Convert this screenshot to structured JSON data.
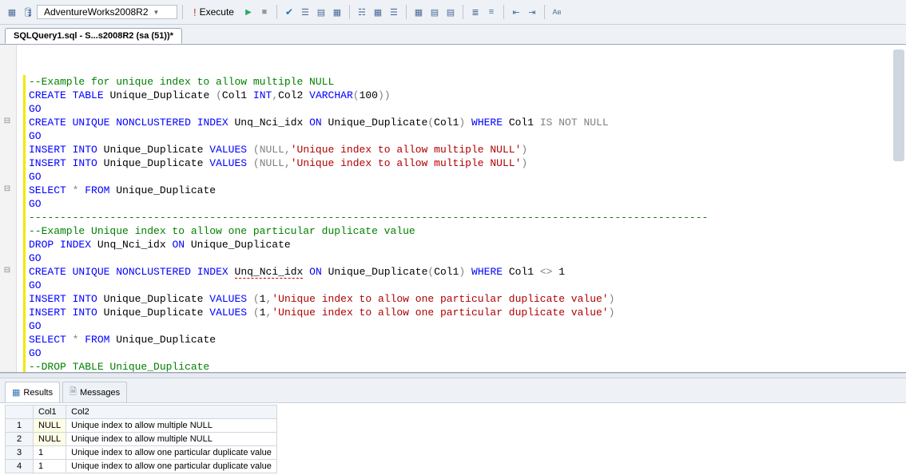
{
  "toolbar": {
    "database": "AdventureWorks2008R2",
    "execute_label": "Execute"
  },
  "tab": {
    "title": "SQLQuery1.sql - S...s2008R2 (sa (51))*"
  },
  "code_lines": [
    {
      "t": "cm",
      "text": "--Example for unique index to allow multiple NULL"
    },
    {
      "t": "sql",
      "html": "<span class='kw'>CREATE</span> <span class='kw'>TABLE</span> Unique_Duplicate <span class='gy'>(</span>Col1 <span class='kw'>INT</span><span class='gy'>,</span>Col2 <span class='kw'>VARCHAR</span><span class='gy'>(</span>100<span class='gy'>))</span>"
    },
    {
      "t": "kw",
      "text": "GO"
    },
    {
      "t": "sql",
      "html": "<span class='kw'>CREATE</span> <span class='kw'>UNIQUE</span> <span class='kw'>NONCLUSTERED</span> <span class='kw'>INDEX</span> Unq_Nci_idx <span class='kw'>ON</span> Unique_Duplicate<span class='gy'>(</span>Col1<span class='gy'>)</span> <span class='kw'>WHERE</span> Col1 <span class='gy'>IS NOT NULL</span>"
    },
    {
      "t": "kw",
      "text": "GO"
    },
    {
      "t": "sql",
      "html": "<span class='kw'>INSERT</span> <span class='kw'>INTO</span> Unique_Duplicate <span class='kw'>VALUES</span> <span class='gy'>(NULL,</span><span class='str'>'Unique index to allow multiple NULL'</span><span class='gy'>)</span>"
    },
    {
      "t": "sql",
      "html": "<span class='kw'>INSERT</span> <span class='kw'>INTO</span> Unique_Duplicate <span class='kw'>VALUES</span> <span class='gy'>(NULL,</span><span class='str'>'Unique index to allow multiple NULL'</span><span class='gy'>)</span>"
    },
    {
      "t": "kw",
      "text": "GO"
    },
    {
      "t": "sql",
      "html": "<span class='kw'>SELECT</span> <span class='gy'>*</span> <span class='kw'>FROM</span> Unique_Duplicate"
    },
    {
      "t": "kw",
      "text": "GO"
    },
    {
      "t": "cm",
      "text": "-------------------------------------------------------------------------------------------------------------"
    },
    {
      "t": "cm",
      "text": "--Example Unique index to allow one particular duplicate value"
    },
    {
      "t": "sql",
      "html": "<span class='kw'>DROP</span> <span class='kw'>INDEX</span> Unq_Nci_idx <span class='kw'>ON</span> Unique_Duplicate"
    },
    {
      "t": "kw",
      "text": "GO"
    },
    {
      "t": "sql",
      "html": "<span class='kw'>CREATE</span> <span class='kw'>UNIQUE</span> <span class='kw'>NONCLUSTERED</span> <span class='kw'>INDEX</span> <span class='squiggle'>Unq_Nci_idx</span> <span class='kw'>ON</span> Unique_Duplicate<span class='gy'>(</span>Col1<span class='gy'>)</span> <span class='kw'>WHERE</span> Col1 <span class='gy'>&lt;&gt;</span> 1"
    },
    {
      "t": "kw",
      "text": "GO"
    },
    {
      "t": "sql",
      "html": "<span class='kw'>INSERT</span> <span class='kw'>INTO</span> Unique_Duplicate <span class='kw'>VALUES</span> <span class='gy'>(</span>1<span class='gy'>,</span><span class='str'>'Unique index to allow one particular duplicate value'</span><span class='gy'>)</span>"
    },
    {
      "t": "sql",
      "html": "<span class='kw'>INSERT</span> <span class='kw'>INTO</span> Unique_Duplicate <span class='kw'>VALUES</span> <span class='gy'>(</span>1<span class='gy'>,</span><span class='str'>'Unique index to allow one particular duplicate value'</span><span class='gy'>)</span>"
    },
    {
      "t": "kw",
      "text": "GO"
    },
    {
      "t": "sql",
      "html": "<span class='kw'>SELECT</span> <span class='gy'>*</span> <span class='kw'>FROM</span> Unique_Duplicate"
    },
    {
      "t": "kw",
      "text": "GO"
    },
    {
      "t": "cm",
      "text": "--DROP TABLE Unique_Duplicate"
    }
  ],
  "outline_marks": [
    5,
    10,
    16
  ],
  "results": {
    "tabs": {
      "results": "Results",
      "messages": "Messages"
    },
    "columns": [
      "",
      "Col1",
      "Col2"
    ],
    "rows": [
      {
        "n": "1",
        "c1": "NULL",
        "c1null": true,
        "c2": "Unique index to allow multiple NULL"
      },
      {
        "n": "2",
        "c1": "NULL",
        "c1null": true,
        "c2": "Unique index to allow multiple NULL"
      },
      {
        "n": "3",
        "c1": "1",
        "c1null": false,
        "c2": "Unique index to allow one particular duplicate value"
      },
      {
        "n": "4",
        "c1": "1",
        "c1null": false,
        "c2": "Unique index to allow one particular duplicate value"
      }
    ]
  }
}
